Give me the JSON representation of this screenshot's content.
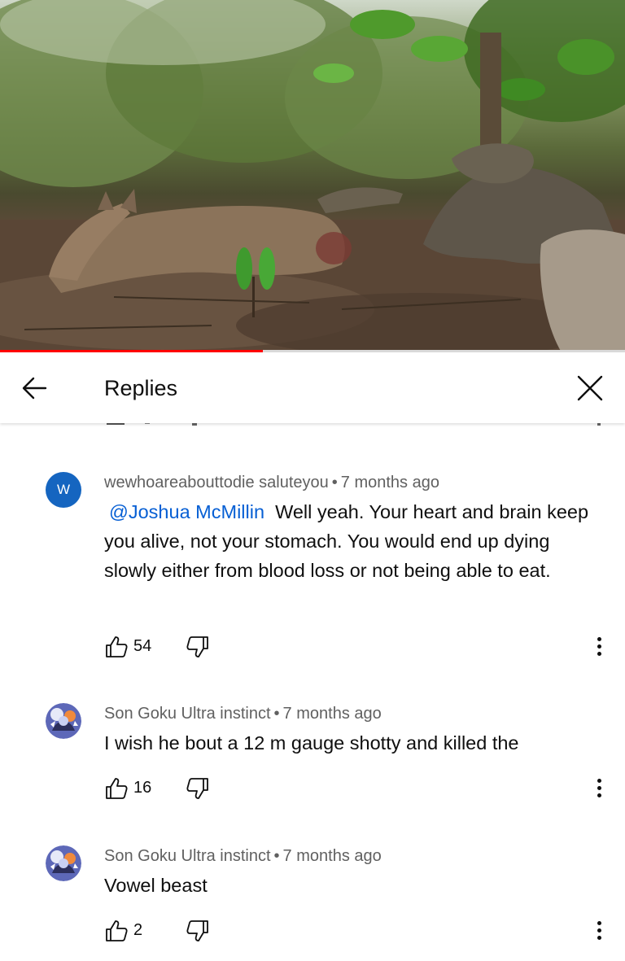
{
  "video": {
    "progress_fraction": 0.42
  },
  "header": {
    "title": "Replies",
    "back_icon": "arrow-left-icon",
    "close_icon": "close-icon"
  },
  "comments": [
    {
      "author": "wewhoareabouttodie saluteyou",
      "avatar_letter": "W",
      "avatar_color": "#1565c0",
      "time": "7 months ago",
      "mention": "@Joshua McMillin",
      "text": "Well yeah. Your heart and brain keep you alive, not your stomach. You would end up dying slowly either from blood loss or not being able to eat.",
      "likes": "54"
    },
    {
      "author": "Son Goku Ultra instinct",
      "time": "7 months ago",
      "text": "I wish he bout a 12 m gauge shotty and killed the",
      "likes": "16"
    },
    {
      "author": "Son Goku Ultra instinct",
      "time": "7 months ago",
      "text": "Vowel beast",
      "likes": "2"
    }
  ],
  "separator": "•",
  "colors": {
    "accent_red": "#ff0000",
    "mention_blue": "#065fd4",
    "meta_gray": "#606060"
  }
}
